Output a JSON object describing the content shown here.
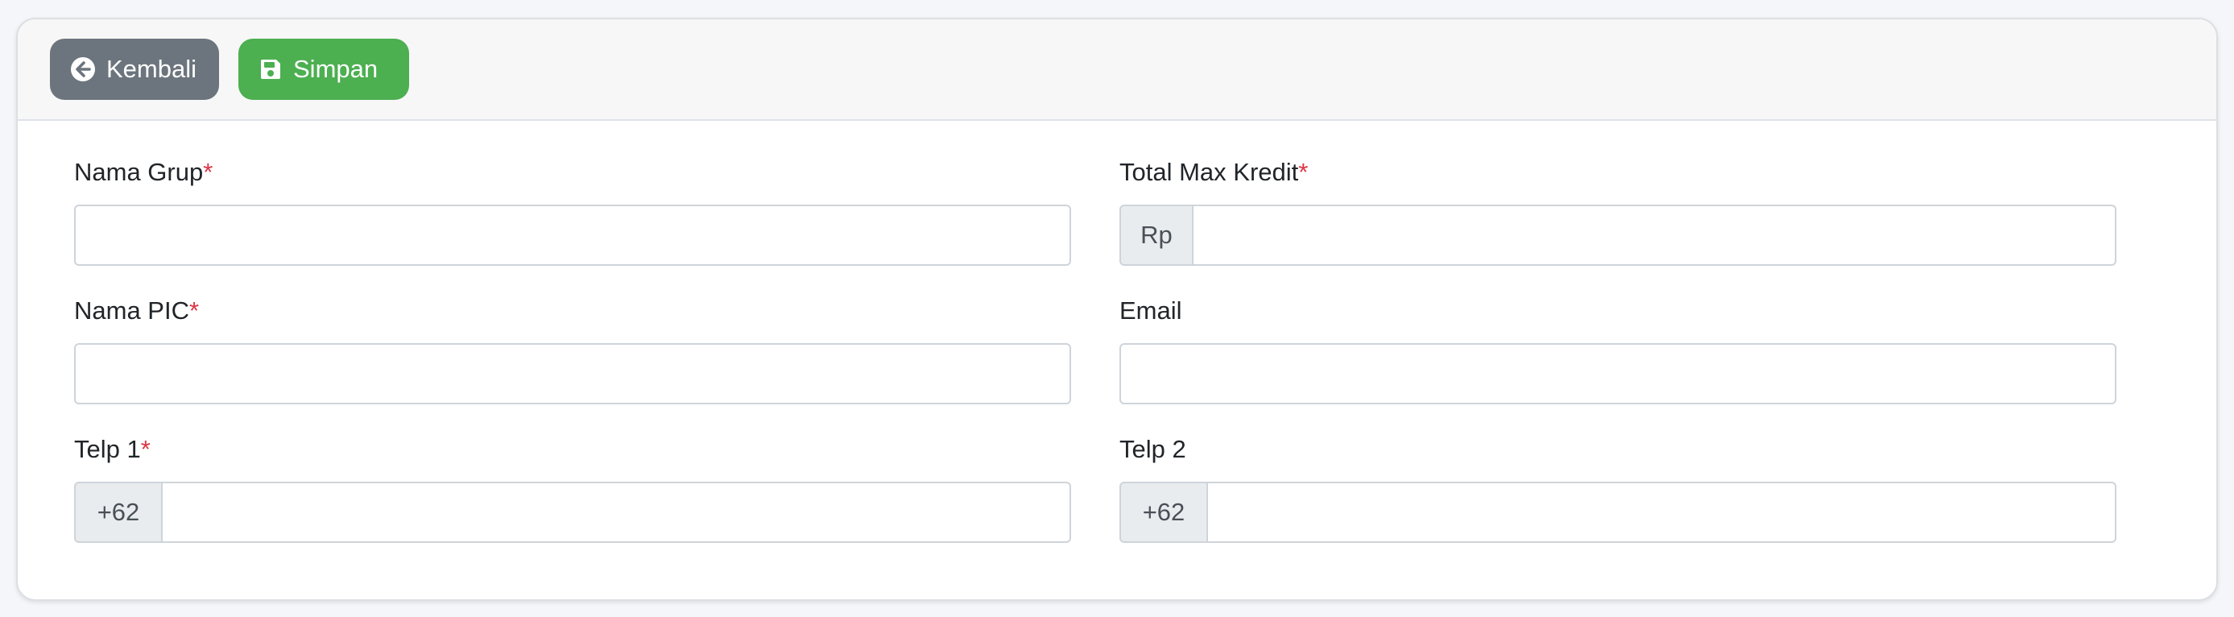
{
  "toolbar": {
    "back_label": "Kembali",
    "save_label": "Simpan"
  },
  "form": {
    "nama_grup": {
      "label": "Nama Grup",
      "required_mark": "*",
      "value": ""
    },
    "total_max_kredit": {
      "label": "Total Max Kredit",
      "required_mark": "*",
      "prefix": "Rp",
      "value": ""
    },
    "nama_pic": {
      "label": "Nama PIC",
      "required_mark": "*",
      "value": ""
    },
    "email": {
      "label": "Email",
      "value": ""
    },
    "telp1": {
      "label": "Telp 1",
      "required_mark": "*",
      "prefix": "+62",
      "value": ""
    },
    "telp2": {
      "label": "Telp 2",
      "prefix": "+62",
      "value": ""
    }
  },
  "colors": {
    "back_button": "#6c757d",
    "save_button": "#4caf50",
    "required": "#dc3545"
  },
  "icons": {
    "back": "arrow-circle-left-icon",
    "save": "floppy-disk-icon"
  }
}
